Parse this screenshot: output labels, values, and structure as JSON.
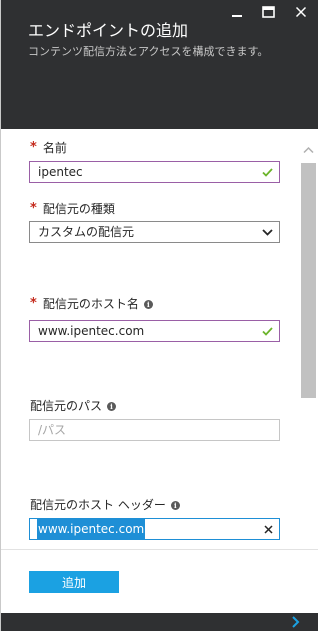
{
  "header": {
    "title": "エンドポイントの追加",
    "subtitle": "コンテンツ配信方法とアクセスを構成できます。",
    "minimize_icon": "minimize-icon",
    "maximize_icon": "maximize-icon",
    "close_icon": "close-icon"
  },
  "form": {
    "name": {
      "label": "名前",
      "required_mark": "*",
      "value": "ipentec",
      "status_icon": "check-icon"
    },
    "origin_type": {
      "label": "配信元の種類",
      "required_mark": "*",
      "value": "カスタムの配信元",
      "dropdown_icon": "chevron-down-icon"
    },
    "origin_host": {
      "label": "配信元のホスト名",
      "required_mark": "*",
      "info_icon": "i",
      "value": "www.ipentec.com",
      "status_icon": "check-icon"
    },
    "origin_path": {
      "label": "配信元のパス",
      "info_icon": "i",
      "placeholder": "/パス"
    },
    "origin_host_header": {
      "label": "配信元のホスト ヘッダー",
      "info_icon": "i",
      "value": "www.ipentec.com",
      "clear_icon": "clear-icon"
    }
  },
  "actions": {
    "add_label": "追加"
  },
  "footer": {
    "expand_icon": "chevron-right-icon"
  },
  "colors": {
    "header_bg": "#2f3032",
    "required": "#c42a1c",
    "valid_border": "#9a5fa6",
    "check": "#6bb42a",
    "focus_border": "#1e8fd6",
    "button_bg": "#1ba1e2"
  }
}
